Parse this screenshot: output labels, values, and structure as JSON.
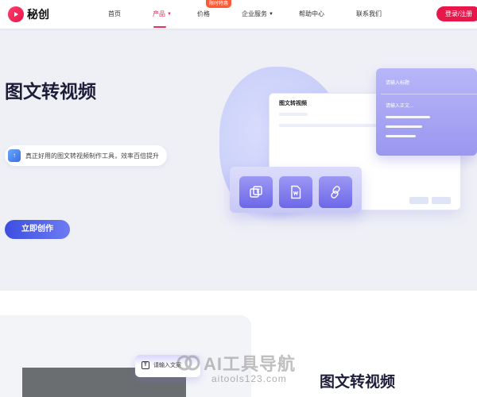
{
  "header": {
    "logo_text": "秘创",
    "nav": [
      {
        "label": "首页"
      },
      {
        "label": "产品",
        "active": true
      },
      {
        "label": "价格",
        "badge": "限时特惠"
      },
      {
        "label": "企业服务"
      },
      {
        "label": "帮助中心"
      },
      {
        "label": "联系我们"
      }
    ],
    "login_label": "登录/注册"
  },
  "hero": {
    "title": "图文转视频",
    "tagline": "真正好用的图文转视频制作工具，效率百倍提升",
    "cta_label": "立即创作",
    "illustration": {
      "main_card_title": "图文转视频",
      "title_placeholder": "请输入标题",
      "body_placeholder": "请输入正文...",
      "tile_icons": [
        "text-icon",
        "word-doc-icon",
        "link-icon"
      ]
    }
  },
  "lower": {
    "input_placeholder": "请输入文案",
    "section_title": "图文转视频"
  },
  "watermark": {
    "text": "AI工具导航",
    "url": "aitools123.com"
  },
  "colors": {
    "brand": "#e8174a",
    "cta": "#3c4fe0",
    "hero_bg": "#eff0f6"
  }
}
